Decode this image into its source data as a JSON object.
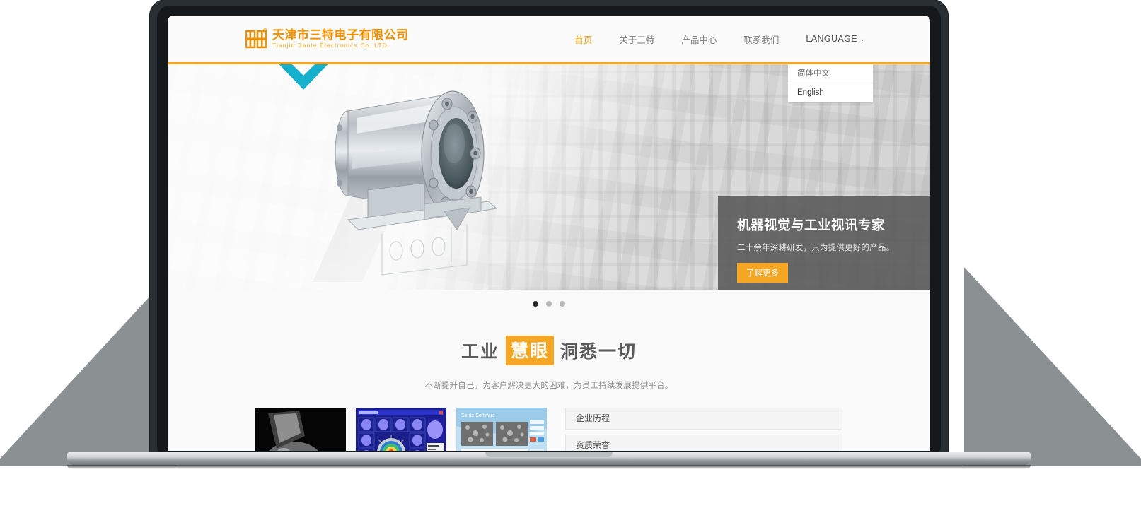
{
  "header": {
    "logo_cn": "天津市三特电子有限公司",
    "logo_en": "Tianjin Sante Electronics Co.,LTD.",
    "nav": [
      {
        "label": "首页",
        "active": true
      },
      {
        "label": "关于三特",
        "active": false
      },
      {
        "label": "产品中心",
        "active": false
      },
      {
        "label": "联系我们",
        "active": false
      }
    ],
    "language_label": "LANGUAGE",
    "language_caret": "⌄",
    "language_menu": [
      {
        "label": "简体中文"
      },
      {
        "label": "English"
      }
    ]
  },
  "hero": {
    "title": "机器视觉与工业视讯专家",
    "subtitle": "二十余年深耕研发，只为提供更好的产品。",
    "button": "了解更多",
    "dots": [
      {
        "active": true
      },
      {
        "active": false
      },
      {
        "active": false
      }
    ]
  },
  "about": {
    "heading_part1": "工业",
    "heading_highlight": "慧眼",
    "heading_part2": "洞悉一切",
    "subtitle": "不断提升自己，为客户解决更大的困难，为员工持续发展提供平台。"
  },
  "accordion": [
    {
      "label": "企业历程"
    },
    {
      "label": "资质荣誉"
    }
  ],
  "colors": {
    "brand_orange": "#f5a623",
    "logo_orange": "#f29100",
    "chevron_teal": "#17b0cc",
    "hero_card": "#585858",
    "nav_text": "#7b7b7b",
    "bezel": "#15191c"
  }
}
